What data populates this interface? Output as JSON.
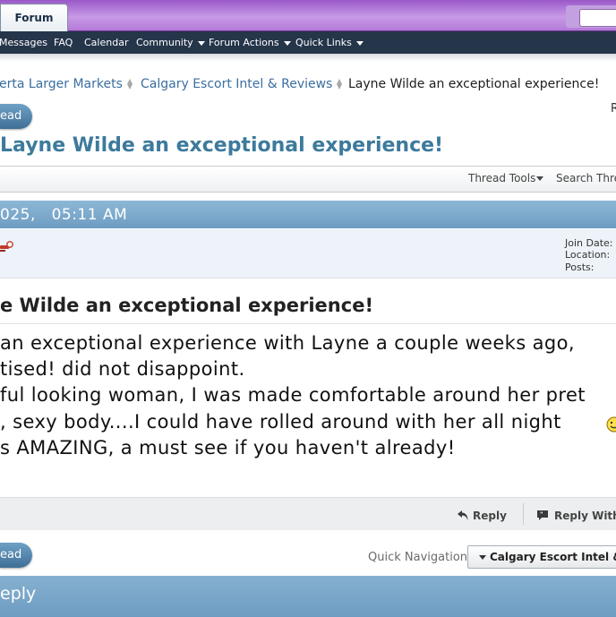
{
  "header": {
    "tab_label": "Forum"
  },
  "nav": {
    "items": [
      {
        "label": "Messages"
      },
      {
        "label": "FAQ"
      },
      {
        "label": "Calendar"
      },
      {
        "label": "Community"
      },
      {
        "label": "Forum Actions"
      },
      {
        "label": "Quick Links"
      }
    ]
  },
  "breadcrumb": {
    "items": [
      {
        "label": "erta Larger Markets"
      },
      {
        "label": "Calgary Escort Intel & Reviews"
      },
      {
        "label": "Layne Wilde an exceptional experience!"
      }
    ]
  },
  "buttons": {
    "top_pill": "ead",
    "bottom_pill": "ead",
    "corner_letter": "R"
  },
  "thread": {
    "title": "Layne Wilde an exceptional experience!",
    "tools_label": "Thread Tools",
    "search_label": "Search Thre"
  },
  "post": {
    "date": "025,   05:11 AM",
    "user_info": {
      "join_date_label": "Join Date:",
      "location_label": "Location:",
      "posts_label": "Posts:"
    },
    "subject": "e Wilde an exceptional experience!",
    "body_lines": [
      " an exceptional experience with Layne a couple weeks ago,",
      "tised! did not disappoint.",
      "ful looking woman, I was made comfortable around her pret",
      ", sexy body....I could have rolled around with her all night",
      "s AMAZING, a must see if you haven't already!"
    ],
    "reply_label": "Reply",
    "reply_with_label": "Reply With"
  },
  "footer": {
    "quick_nav_label": "Quick Navigation",
    "quick_nav_value": "Calgary Escort Intel & Reviews",
    "reply_bar_label": "eply"
  },
  "colors": {
    "top_bar": "#b47ad8",
    "nav_bar": "#25354a",
    "link": "#3a6ea0",
    "title": "#3d7a9c",
    "post_header": "#6d9cc2"
  },
  "icons": [
    "user-online-icon",
    "breadcrumb-separator-icon",
    "reply-icon",
    "quote-reply-icon",
    "smiley-icon"
  ]
}
